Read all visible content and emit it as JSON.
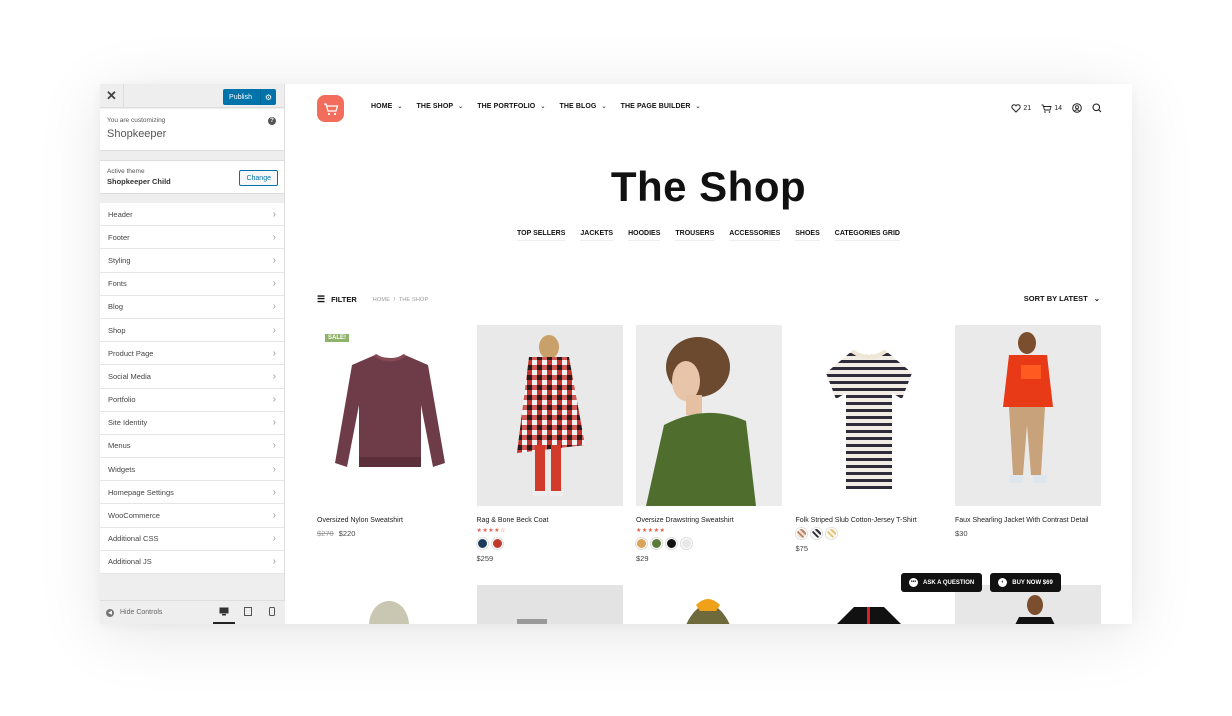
{
  "customizer": {
    "close_icon": "close-icon",
    "publish_label": "Publish",
    "settings_icon": "gear-icon",
    "customizing_label": "You are customizing",
    "site_name": "Shopkeeper",
    "help_icon": "help-icon",
    "active_theme_label": "Active theme",
    "active_theme": "Shopkeeper Child",
    "change_label": "Change",
    "sections": [
      {
        "label": "Header"
      },
      {
        "label": "Footer"
      },
      {
        "label": "Styling"
      },
      {
        "label": "Fonts"
      },
      {
        "label": "Blog"
      },
      {
        "label": "Shop"
      },
      {
        "label": "Product Page"
      },
      {
        "label": "Social Media"
      },
      {
        "label": "Portfolio"
      },
      {
        "label": "Site Identity"
      },
      {
        "label": "Menus"
      },
      {
        "label": "Widgets"
      },
      {
        "label": "Homepage Settings"
      },
      {
        "label": "WooCommerce"
      },
      {
        "label": "Additional CSS"
      },
      {
        "label": "Additional JS"
      }
    ],
    "hide_controls_label": "Hide Controls",
    "devices": [
      "desktop",
      "tablet",
      "mobile"
    ],
    "active_device": "desktop"
  },
  "site": {
    "brand_color": "#f26d5b",
    "nav": [
      {
        "label": "HOME"
      },
      {
        "label": "THE SHOP"
      },
      {
        "label": "THE PORTFOLIO"
      },
      {
        "label": "THE BLOG"
      },
      {
        "label": "THE PAGE BUILDER"
      }
    ],
    "wishlist_count": "21",
    "cart_count": "14",
    "page_title": "The Shop",
    "categories": [
      "TOP SELLERS",
      "JACKETS",
      "HOODIES",
      "TROUSERS",
      "ACCESSORIES",
      "SHOES",
      "CATEGORIES GRID"
    ],
    "filter_label": "FILTER",
    "breadcrumb": [
      "HOME",
      "/",
      "THE SHOP"
    ],
    "sort_label": "SORT BY LATEST",
    "products": [
      {
        "name": "Oversized Nylon Sweatshirt",
        "badge": "SALE!",
        "old_price": "$270",
        "price": "$220",
        "rating": null,
        "swatches": []
      },
      {
        "name": "Rag & Bone Beck Coat",
        "badge": null,
        "old_price": null,
        "price": "$259",
        "rating": 4,
        "stars": "★★★★☆",
        "swatches": [
          "#1b3a5c",
          "#c0392b"
        ]
      },
      {
        "name": "Oversize Drawstring Sweatshirt",
        "badge": null,
        "old_price": null,
        "price": "$29",
        "rating": 5,
        "stars": "★★★★★",
        "swatches": [
          "#d9a35a",
          "#5a7a3a",
          "#111111",
          "#e8e8e8"
        ]
      },
      {
        "name": "Folk Striped Slub Cotton-Jersey T-Shirt",
        "badge": null,
        "old_price": null,
        "price": "$75",
        "rating": null,
        "swatches": [
          "#b8826a",
          "#2a2a33",
          "#e0c27a"
        ]
      },
      {
        "name": "Faux Shearling Jacket With Contrast Detail",
        "badge": null,
        "old_price": null,
        "price": "$30",
        "rating": null,
        "swatches": []
      }
    ],
    "ask_question_label": "ASK A QUESTION",
    "buy_now_label": "BUY NOW $69"
  }
}
